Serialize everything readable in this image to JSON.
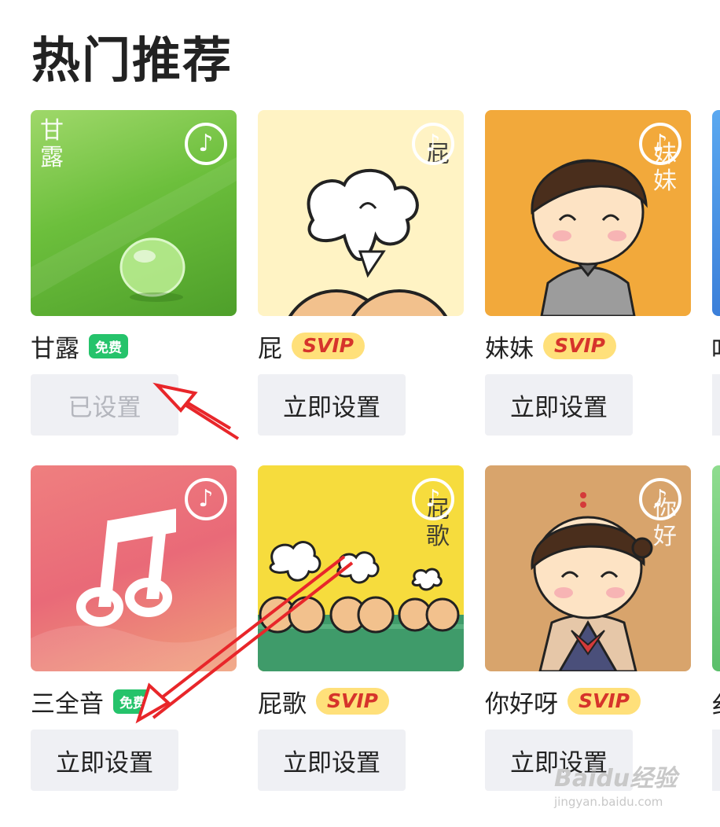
{
  "page": {
    "title": "热门推荐"
  },
  "ringtones": [
    {
      "name": "甘露",
      "badge": "免费",
      "badge_type": "free",
      "button": "已设置",
      "button_state": "set",
      "cover_text": "甘露"
    },
    {
      "name": "屁",
      "badge": "SVIP",
      "badge_type": "svip",
      "button": "立即设置",
      "button_state": "available",
      "cover_text": "屁"
    },
    {
      "name": "妹妹",
      "badge": "SVIP",
      "badge_type": "svip",
      "button": "立即设置",
      "button_state": "available",
      "cover_text": "妹妹"
    },
    {
      "name": "三全音",
      "badge": "免费",
      "badge_type": "free",
      "button": "立即设置",
      "button_state": "available",
      "cover_text": ""
    },
    {
      "name": "屁歌",
      "badge": "SVIP",
      "badge_type": "svip",
      "button": "立即设置",
      "button_state": "available",
      "cover_text": "屁歌"
    },
    {
      "name": "你好呀",
      "badge": "SVIP",
      "badge_type": "svip",
      "button": "立即设置",
      "button_state": "available",
      "cover_text": "你好"
    }
  ],
  "partial_next": [
    {
      "name_glyph": "吖"
    },
    {
      "name_glyph": "纟"
    }
  ],
  "watermark": {
    "brand": "Baidu经验",
    "url": "jingyan.baidu.com"
  },
  "colors": {
    "free_badge": "#25c36b",
    "svip_badge_bg": "#ffe07a",
    "svip_badge_text": "#d6342b",
    "button_bg": "#eff0f4",
    "annotation_arrow": "#e8262a"
  },
  "icons": {
    "cover_corner": "music-note-icon"
  }
}
